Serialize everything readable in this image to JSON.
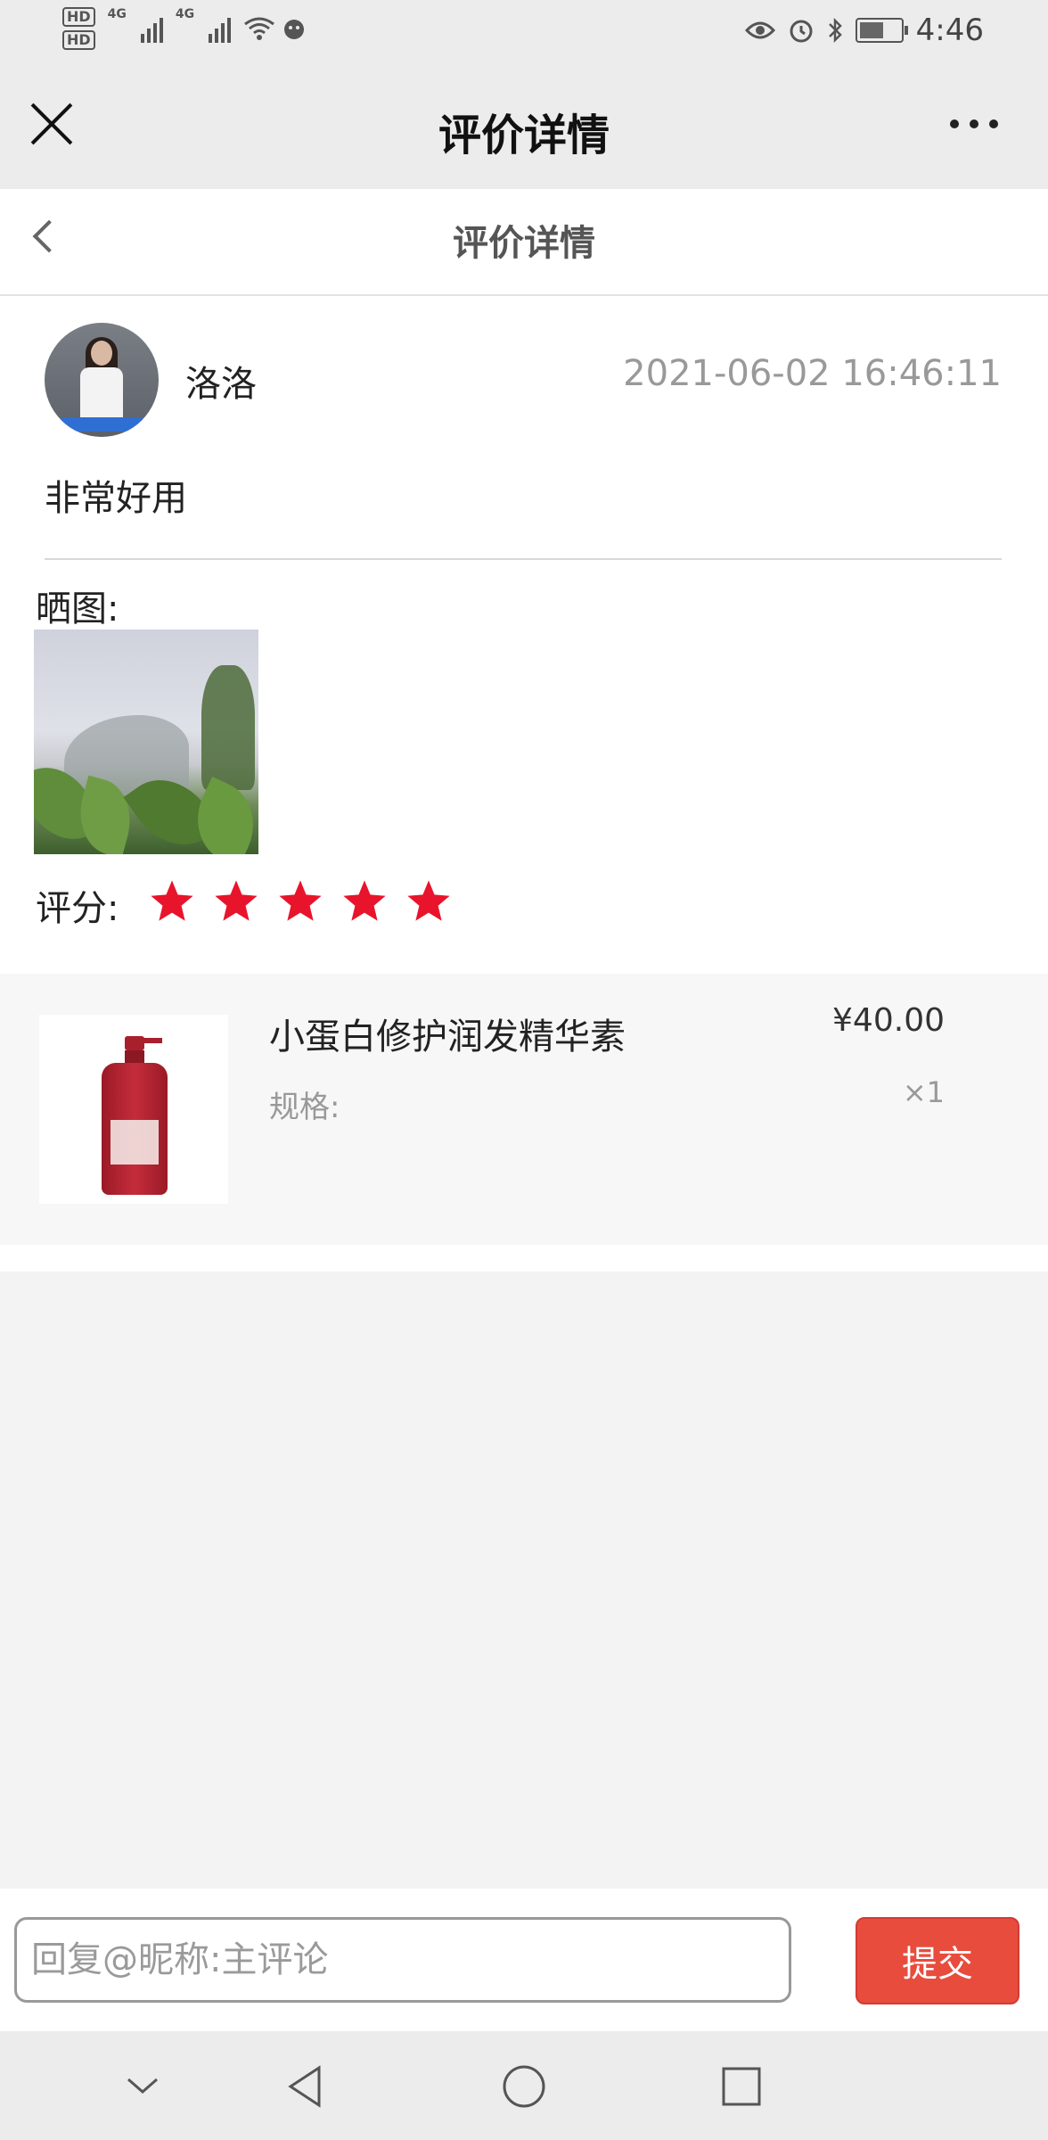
{
  "status_bar": {
    "hd1": "HD",
    "hd2": "HD",
    "net1": "4G",
    "net2": "4G",
    "battery_level": 0.6,
    "time": "4:46"
  },
  "nav": {
    "title": "评价详情"
  },
  "page_header": {
    "title": "评价详情"
  },
  "review": {
    "username": "洛洛",
    "timestamp": "2021-06-02 16:46:11",
    "content": "非常好用",
    "photos_label": "晒图:",
    "rating_label": "评分:",
    "rating": 5,
    "rating_max": 5,
    "star_color": "#e8142c"
  },
  "product": {
    "name": "小蛋白修护润发精华素",
    "spec_label": "规格:",
    "price": "¥40.00",
    "quantity": "×1"
  },
  "reply": {
    "placeholder": "回复@昵称:主评论",
    "submit_label": "提交",
    "accent": "#e84c3d"
  },
  "icons": {
    "close": "close-icon",
    "more": "more-icon",
    "back": "back-icon",
    "star": "star-icon",
    "sys_down": "chevron-down-icon",
    "sys_back": "triangle-back-icon",
    "sys_home": "circle-home-icon",
    "sys_recent": "square-recent-icon"
  }
}
